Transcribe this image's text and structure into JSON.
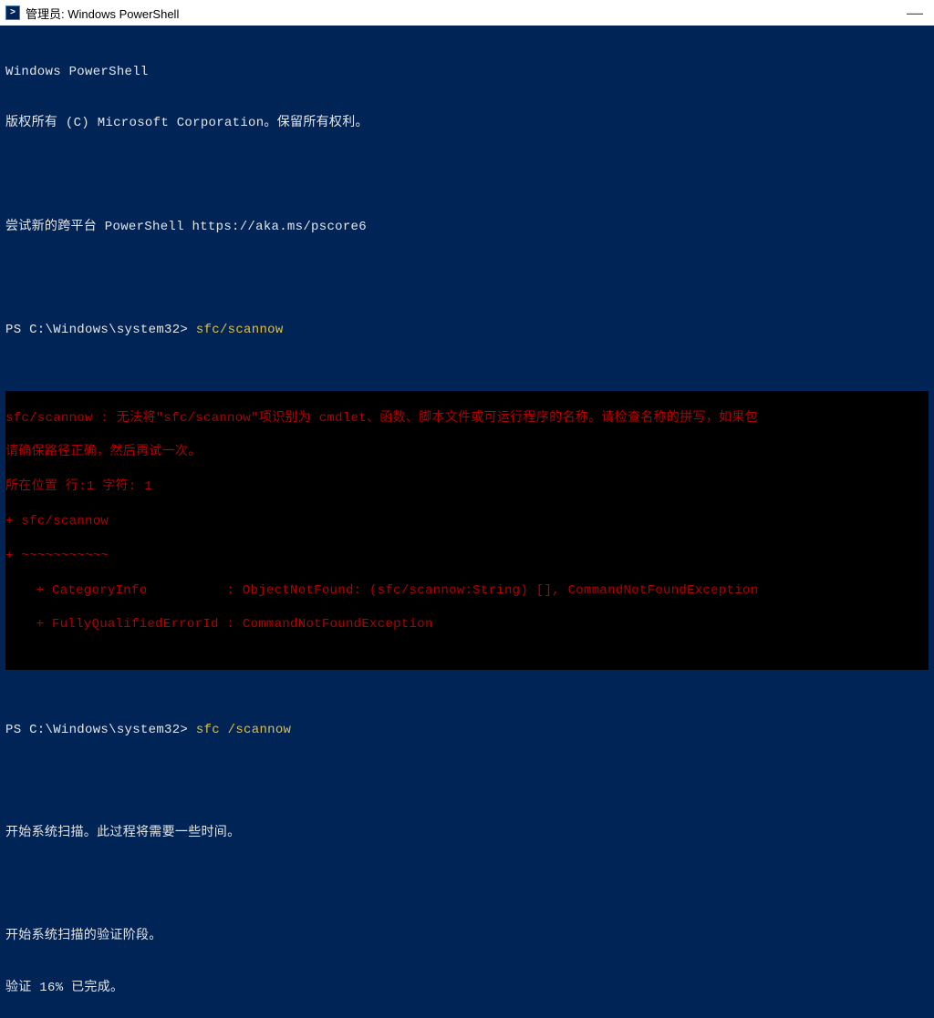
{
  "window": {
    "icon_glyph": ">",
    "title": "管理员: Windows PowerShell"
  },
  "header": {
    "line1": "Windows PowerShell",
    "line2": "版权所有 (C) Microsoft Corporation。保留所有权利。",
    "line3": "尝试新的跨平台 PowerShell https://aka.ms/pscore6"
  },
  "cmd1": {
    "prompt": "PS C:\\Windows\\system32> ",
    "input": "sfc/scannow"
  },
  "error": {
    "l1": "sfc/scannow : 无法将\"sfc/scannow\"项识别为 cmdlet、函数、脚本文件或可运行程序的名称。请检查名称的拼写，如果包",
    "l2": "请确保路径正确，然后再试一次。",
    "l3": "所在位置 行:1 字符: 1",
    "l4": "+ sfc/scannow",
    "l5": "+ ~~~~~~~~~~~",
    "l6": "+ CategoryInfo          : ObjectNotFound: (sfc/scannow:String) [], CommandNotFoundException",
    "l7": "+ FullyQualifiedErrorId : CommandNotFoundException"
  },
  "cmd2": {
    "prompt": "PS C:\\Windows\\system32> ",
    "input": "sfc /scannow"
  },
  "out": {
    "l1": "开始系统扫描。此过程将需要一些时间。",
    "l2": "开始系统扫描的验证阶段。",
    "l3": "验证 16% 已完成。"
  }
}
